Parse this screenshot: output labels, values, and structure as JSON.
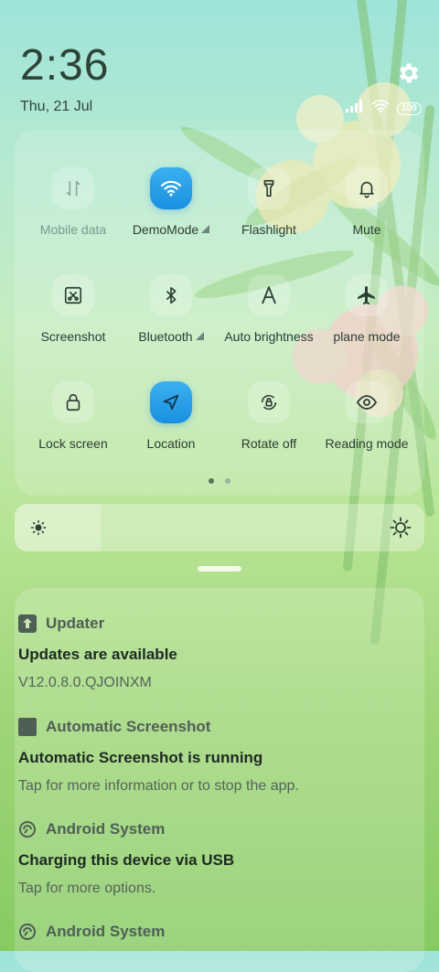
{
  "status": {
    "time": "2:36",
    "date": "Thu, 21 Jul",
    "battery": "100"
  },
  "quick_settings": {
    "tiles": [
      {
        "label": "Mobile data",
        "icon": "mobile-data-icon",
        "active": false,
        "dim": true,
        "arrow": false
      },
      {
        "label": "DemoMode",
        "icon": "wifi-icon",
        "active": true,
        "dim": false,
        "arrow": true
      },
      {
        "label": "Flashlight",
        "icon": "flashlight-icon",
        "active": false,
        "dim": false,
        "arrow": false
      },
      {
        "label": "Mute",
        "icon": "bell-icon",
        "active": false,
        "dim": false,
        "arrow": false
      },
      {
        "label": "Screenshot",
        "icon": "screenshot-icon",
        "active": false,
        "dim": false,
        "arrow": false
      },
      {
        "label": "Bluetooth",
        "icon": "bluetooth-icon",
        "active": false,
        "dim": false,
        "arrow": true
      },
      {
        "label": "Auto brightness",
        "icon": "auto-brightness-icon",
        "active": false,
        "dim": false,
        "arrow": false
      },
      {
        "label": "plane mode",
        "icon": "airplane-icon",
        "active": false,
        "dim": false,
        "arrow": false
      },
      {
        "label": "Lock screen",
        "icon": "lock-icon",
        "active": false,
        "dim": false,
        "arrow": false
      },
      {
        "label": "Location",
        "icon": "location-icon",
        "active": true,
        "dim": false,
        "arrow": false
      },
      {
        "label": "Rotate off",
        "icon": "rotate-lock-icon",
        "active": false,
        "dim": false,
        "arrow": false
      },
      {
        "label": "Reading mode",
        "icon": "eye-icon",
        "active": false,
        "dim": false,
        "arrow": false
      }
    ],
    "page_count": 2,
    "current_page": 1
  },
  "brightness": {
    "level": 0.21
  },
  "notifications": [
    {
      "app": "Updater",
      "title": "Updates are available",
      "text": "V12.0.8.0.QJOINXM",
      "icon": "updater-icon"
    },
    {
      "app": "Automatic Screenshot",
      "title": "Automatic Screenshot is running",
      "text": "Tap for more information or to stop the app.",
      "icon": "app-square-icon"
    },
    {
      "app": "Android System",
      "title": "Charging this device via USB",
      "text": "Tap for more options.",
      "icon": "android-system-icon"
    },
    {
      "app": "Android System",
      "title": "",
      "text": "",
      "icon": "android-system-icon"
    }
  ],
  "colors": {
    "active_tile": "#1a8fe0"
  }
}
